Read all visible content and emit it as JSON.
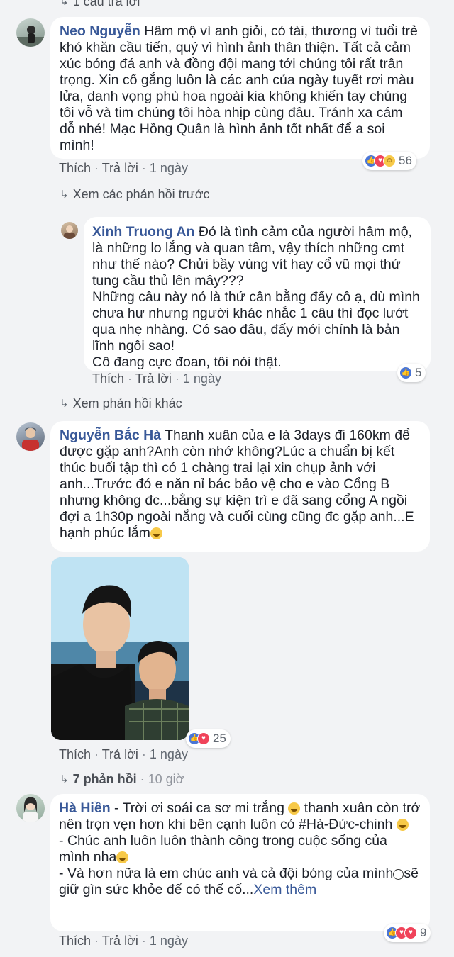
{
  "top": {
    "replies_label": "1 câu trả lời"
  },
  "common": {
    "like": "Thích",
    "reply": "Trả lời",
    "sep": "·"
  },
  "comments": [
    {
      "author": "Neo Nguyễn",
      "text": "Hâm mộ vì anh giỏi, có tài, thương vì tuổi trẻ khó khăn cầu tiến, quý vì hình ảnh thân thiện. Tất cả cảm xúc bóng đá anh và đồng đội mang tới chúng tôi rất trân trọng. Xin cố gắng luôn là các anh của ngày tuyết rơi màu lửa, danh vọng phù hoa ngoài kia không khiến tay chúng tôi vỗ và tim chúng tôi hòa nhịp cùng đâu. Tránh xa cám dỗ nhé! Mạc Hồng Quân là hình ảnh tốt nhất để a soi mình!",
      "time": "1 ngày",
      "reaction_count": "56"
    },
    {
      "author": "Xinh Truong An",
      "text": "Đó là tình cảm của người hâm mộ, là những lo lắng và quan tâm, vậy thích những cmt như thế nào? Chửi bầy vùng vít hay cổ vũ mọi thứ tung cầu thủ lên mây???",
      "text2": "Những câu này nó là thứ cân bằng đấy cô ạ, dù mình chưa hư nhưng người khác nhắc 1 câu thì đọc lướt qua nhẹ nhàng. Có sao đâu, đấy mới chính là bản lĩnh ngôi sao!",
      "text3": "Cô đang cực đoan, tôi nói thật.",
      "time": "1 ngày",
      "reaction_count": "5"
    },
    {
      "author": "Nguyễn Bắc Hà",
      "text": "Thanh xuân của e là 3days đi 160km để được gặp anh?Anh còn nhớ không?Lúc a chuẩn bị kết thúc buổi tập thì có 1 chàng trai lại xin chụp ảnh với anh...Trước đó e năn nỉ bác bảo vệ cho e vào Cổng B nhưng không đc...bằng sự kiện trì e đã sang cổng A ngồi đợi a 1h30p ngoài nắng và cuối cùng cũng đc gặp anh...E hạnh phúc lắm",
      "time": "1 ngày",
      "reaction_count": "25",
      "replies": "7 phản hồi",
      "replies_time": "10 giờ"
    },
    {
      "author": "Hà Hiền",
      "line1_pre": "- Trời ơi soái ca sơ mi trắng",
      "line1_post": "thanh xuân còn trở nên trọn vẹn hơn khi bên cạnh luôn có #Hà-Đức-chinh",
      "line2": "- Chúc anh luôn luôn thành công trong cuộc sống của mình nha",
      "line3_pre": "- Và hơn nữa là em chúc anh và cả đội bóng của mình",
      "line3_post": "sẽ giữ gìn sức khỏe để có thể cố...",
      "see_more": "Xem thêm",
      "time": "1 ngày",
      "reaction_count": "9"
    }
  ],
  "links": {
    "previous_replies": "Xem các phản hồi trước",
    "other_replies": "Xem phản hồi khác"
  }
}
